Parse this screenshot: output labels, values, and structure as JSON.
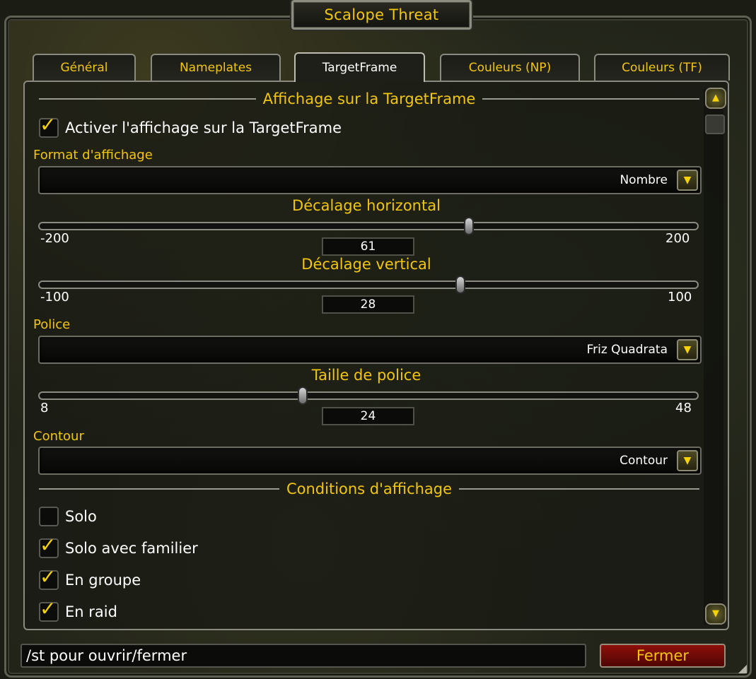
{
  "window": {
    "title": "Scalope Threat"
  },
  "tabs": [
    {
      "label": "Général"
    },
    {
      "label": "Nameplates"
    },
    {
      "label": "TargetFrame",
      "active": true
    },
    {
      "label": "Couleurs (NP)"
    },
    {
      "label": "Couleurs (TF)"
    }
  ],
  "section1": {
    "title": "Affichage sur la TargetFrame"
  },
  "enable": {
    "label": "Activer l'affichage sur la TargetFrame",
    "checked": true
  },
  "format": {
    "label": "Format d'affichage",
    "value": "Nombre"
  },
  "offset_h": {
    "title": "Décalage horizontal",
    "min": "-200",
    "max": "200",
    "value": "61",
    "fraction": 0.6525
  },
  "offset_v": {
    "title": "Décalage vertical",
    "min": "-100",
    "max": "100",
    "value": "28",
    "fraction": 0.64
  },
  "font": {
    "label": "Police",
    "value": "Friz Quadrata"
  },
  "font_size": {
    "title": "Taille de police",
    "min": "8",
    "max": "48",
    "value": "24",
    "fraction": 0.4
  },
  "outline": {
    "label": "Contour",
    "value": "Contour"
  },
  "section2": {
    "title": "Conditions d'affichage"
  },
  "conditions": [
    {
      "label": "Solo",
      "checked": false
    },
    {
      "label": "Solo avec familier",
      "checked": true
    },
    {
      "label": "En groupe",
      "checked": true
    },
    {
      "label": "En raid",
      "checked": true
    }
  ],
  "footer": {
    "hint": "/st pour ouvrir/fermer",
    "close_label": "Fermer"
  },
  "icons": {
    "check": "check-icon",
    "dropdown": "dropdown-arrow-icon",
    "scroll_up": "scroll-up-icon",
    "scroll_down": "scroll-down-icon",
    "resize": "resize-grip-icon"
  },
  "colors": {
    "accent": "#f2c60d",
    "close_button": "#8e0f0a"
  }
}
